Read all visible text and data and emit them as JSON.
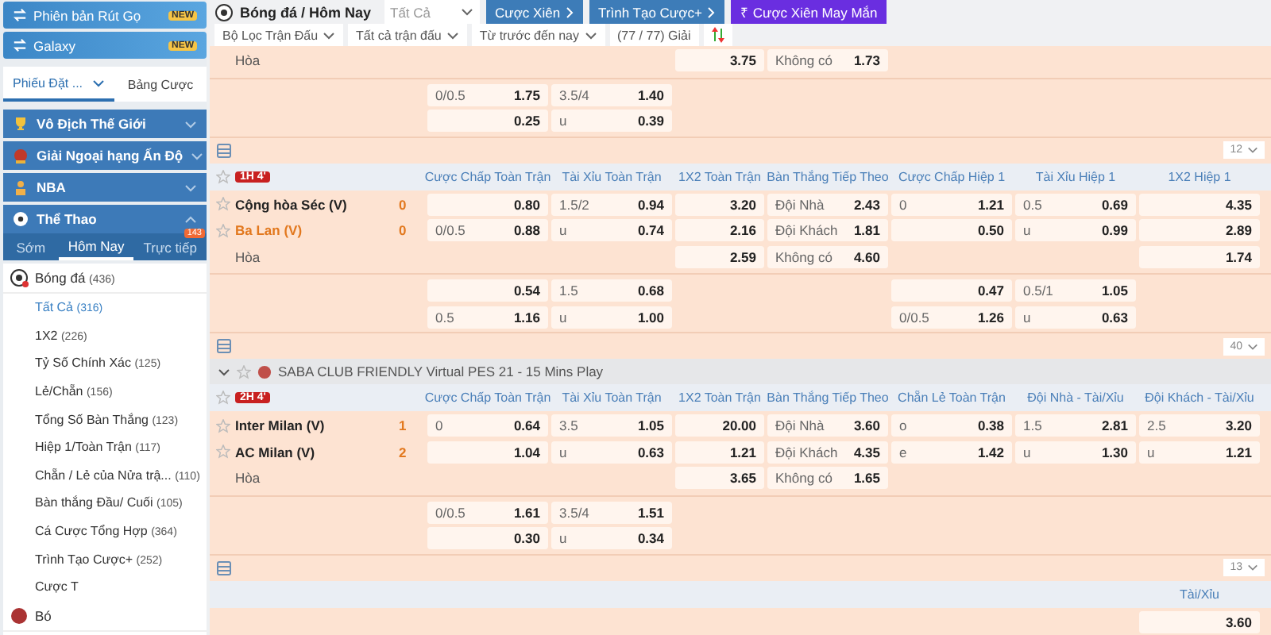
{
  "sidebar": {
    "promo_buttons": [
      {
        "label": "Phiên bản Rút Gọ",
        "badge": "NEW"
      },
      {
        "label": "Galaxy",
        "badge": "NEW"
      }
    ],
    "tabs": [
      {
        "label": "Phiếu Đặt ...",
        "selected": true
      },
      {
        "label": "Bảng Cược",
        "selected": false
      }
    ],
    "sections": [
      {
        "label": "Vô Địch Thế Giới",
        "kind": "trophy",
        "expanded": false
      },
      {
        "label": "Giải Ngoại hạng Ấn Độ",
        "kind": "cricket",
        "expanded": false
      },
      {
        "label": "NBA",
        "kind": "basketball",
        "expanded": false
      },
      {
        "label": "Thể Thao",
        "kind": "sports",
        "expanded": true
      }
    ],
    "sport_tabs": [
      {
        "label": "Sớm",
        "selected": false
      },
      {
        "label": "Hôm Nay",
        "selected": true
      },
      {
        "label": "Trực tiếp",
        "selected": false,
        "badge": "143"
      }
    ],
    "sport": {
      "label": "Bóng đá",
      "count": "(436)"
    },
    "markets": [
      {
        "label": "Tất Cả",
        "count": "(316)",
        "selected": true
      },
      {
        "label": "1X2",
        "count": "(226)",
        "selected": false
      },
      {
        "label": "Tỷ Số Chính Xác",
        "count": "(125)",
        "selected": false
      },
      {
        "label": "Lẻ/Chẵn",
        "count": "(156)",
        "selected": false
      },
      {
        "label": "Tổng Số Bàn Thắng",
        "count": "(123)",
        "selected": false
      },
      {
        "label": "Hiệp 1/Toàn Trận",
        "count": "(117)",
        "selected": false
      },
      {
        "label": "Chẵn / Lẻ của Nửa trậ...",
        "count": "(110)",
        "selected": false
      },
      {
        "label": "Bàn thắng Đầu/ Cuối",
        "count": "(105)",
        "selected": false
      },
      {
        "label": "Cá Cược Tổng Hợp",
        "count": "(364)",
        "selected": false
      },
      {
        "label": "Trình Tạo Cược+",
        "count": "(252)",
        "selected": false
      },
      {
        "label": "Cược T",
        "selected": false
      }
    ],
    "next_sport": {
      "label": "Bó"
    }
  },
  "header": {
    "breadcrumb": "Bóng đá / Hôm Nay",
    "select": "Tất Cả",
    "buttons": [
      {
        "label": "Cược Xiên",
        "kind": "blue"
      },
      {
        "label": "Trình Tạo Cược+",
        "kind": "blue"
      },
      {
        "label": "Cược Xiên May Mắn",
        "kind": "purple",
        "icon": "₹"
      }
    ],
    "filters": [
      "Bộ Lọc Trận Đấu",
      "Tất cả trận đấu",
      "Từ trước đến nay"
    ],
    "league_count": "(77 / 77) Giải"
  },
  "matches": [
    {
      "rows": [
        {
          "team": "Hòa",
          "cells": [
            null,
            null,
            [
              "",
              "3.75"
            ],
            [
              "Không có",
              "1.73"
            ],
            null,
            null,
            null
          ]
        }
      ],
      "extra_rows": [
        {
          "cells": [
            [
              "0/0.5",
              "1.75"
            ],
            [
              "3.5/4",
              "1.40"
            ],
            null,
            null,
            null,
            null,
            null
          ]
        },
        {
          "cells": [
            [
              "",
              "0.25"
            ],
            [
              "u",
              "0.39"
            ],
            null,
            null,
            null,
            null,
            null
          ]
        }
      ],
      "footer_select": "12"
    },
    {
      "badge": "1H 4'",
      "headers": [
        "Cược Chấp Toàn Trận",
        "Tài Xỉu Toàn Trận",
        "1X2 Toàn Trận",
        "Bàn Thắng Tiếp Theo",
        "Cược Chấp Hiệp 1",
        "Tài Xỉu Hiệp 1",
        "1X2 Hiệp 1"
      ],
      "rows": [
        {
          "team": "Cộng hòa Séc (V)",
          "score": "0",
          "highlighted": false,
          "cells": [
            [
              "",
              "0.80"
            ],
            [
              "1.5/2",
              "0.94"
            ],
            [
              "",
              "3.20"
            ],
            [
              "Đội Nhà",
              "2.43"
            ],
            [
              "0",
              "1.21"
            ],
            [
              "0.5",
              "0.69"
            ],
            [
              "",
              "4.35"
            ]
          ]
        },
        {
          "team": "Ba Lan (V)",
          "score": "0",
          "highlighted": true,
          "cells": [
            [
              "0/0.5",
              "0.88"
            ],
            [
              "u",
              "0.74"
            ],
            [
              "",
              "2.16"
            ],
            [
              "Đội Khách",
              "1.81"
            ],
            [
              "",
              "0.50"
            ],
            [
              "u",
              "0.99"
            ],
            [
              "",
              "2.89"
            ]
          ]
        },
        {
          "team": "Hòa",
          "cells": [
            null,
            null,
            [
              "",
              "2.59"
            ],
            [
              "Không có",
              "4.60"
            ],
            null,
            null,
            [
              "",
              "1.74"
            ]
          ]
        }
      ],
      "extra_rows": [
        {
          "cells": [
            [
              "",
              "0.54"
            ],
            [
              "1.5",
              "0.68"
            ],
            null,
            null,
            [
              "",
              "0.47"
            ],
            [
              "0.5/1",
              "1.05"
            ],
            null
          ]
        },
        {
          "cells": [
            [
              "0.5",
              "1.16"
            ],
            [
              "u",
              "1.00"
            ],
            null,
            null,
            [
              "0/0.5",
              "1.26"
            ],
            [
              "u",
              "0.63"
            ],
            null
          ]
        }
      ],
      "footer_select": "40"
    },
    {
      "league": "SABA CLUB FRIENDLY Virtual PES 21 - 15 Mins Play",
      "badge": "2H 4'",
      "headers": [
        "Cược Chấp Toàn Trận",
        "Tài Xỉu Toàn Trận",
        "1X2 Toàn Trận",
        "Bàn Thắng Tiếp Theo",
        "Chẵn Lẻ Toàn Trận",
        "Đội Nhà - Tài/Xỉu",
        "Đội Khách - Tài/Xỉu"
      ],
      "rows": [
        {
          "team": "Inter Milan (V)",
          "score": "1",
          "highlighted": false,
          "cells": [
            [
              "0",
              "0.64"
            ],
            [
              "3.5",
              "1.05"
            ],
            [
              "",
              "20.00"
            ],
            [
              "Đội Nhà",
              "3.60"
            ],
            [
              "o",
              "0.38"
            ],
            [
              "1.5",
              "2.81"
            ],
            [
              "2.5",
              "3.20"
            ]
          ]
        },
        {
          "team": "AC Milan (V)",
          "score": "2",
          "highlighted": false,
          "cells": [
            [
              "",
              "1.04"
            ],
            [
              "u",
              "0.63"
            ],
            [
              "",
              "1.21"
            ],
            [
              "Đội Khách",
              "4.35"
            ],
            [
              "e",
              "1.42"
            ],
            [
              "u",
              "1.30"
            ],
            [
              "u",
              "1.21"
            ]
          ]
        },
        {
          "team": "Hòa",
          "cells": [
            null,
            null,
            [
              "",
              "3.65"
            ],
            [
              "Không có",
              "1.65"
            ],
            null,
            null,
            null
          ]
        }
      ],
      "extra_rows": [
        {
          "cells": [
            [
              "0/0.5",
              "1.61"
            ],
            [
              "3.5/4",
              "1.51"
            ],
            null,
            null,
            null,
            null,
            null
          ]
        },
        {
          "cells": [
            [
              "",
              "0.30"
            ],
            [
              "u",
              "0.34"
            ],
            null,
            null,
            null,
            null,
            null
          ]
        }
      ],
      "footer_select": "13"
    },
    {
      "last_header": "Tài/Xỉu",
      "rows": [
        {
          "cells": [
            null,
            null,
            null,
            null,
            null,
            null,
            [
              "",
              "3.60"
            ]
          ]
        }
      ]
    }
  ]
}
